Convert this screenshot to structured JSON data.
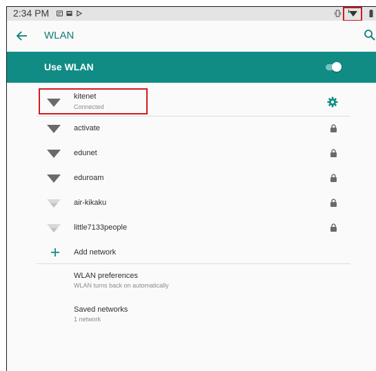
{
  "status_bar": {
    "time": "2:34 PM"
  },
  "app_bar": {
    "title": "WLAN"
  },
  "use_wlan": {
    "label": "Use WLAN",
    "enabled": true
  },
  "connected_network": {
    "name": "kitenet",
    "status": "Connected"
  },
  "networks": [
    {
      "name": "activate",
      "signal": "strong",
      "secured": true
    },
    {
      "name": "edunet",
      "signal": "strong",
      "secured": true
    },
    {
      "name": "eduroam",
      "signal": "strong",
      "secured": true
    },
    {
      "name": "air-kikaku",
      "signal": "weak",
      "secured": true
    },
    {
      "name": "little7133people",
      "signal": "weak",
      "secured": true
    }
  ],
  "add_network": {
    "label": "Add network"
  },
  "preferences": {
    "title": "WLAN preferences",
    "subtitle": "WLAN turns back on automatically"
  },
  "saved_networks": {
    "title": "Saved networks",
    "subtitle": "1 network"
  },
  "colors": {
    "accent": "#108c85",
    "title_accent": "#0e7d76",
    "highlight": "#d0191f"
  }
}
